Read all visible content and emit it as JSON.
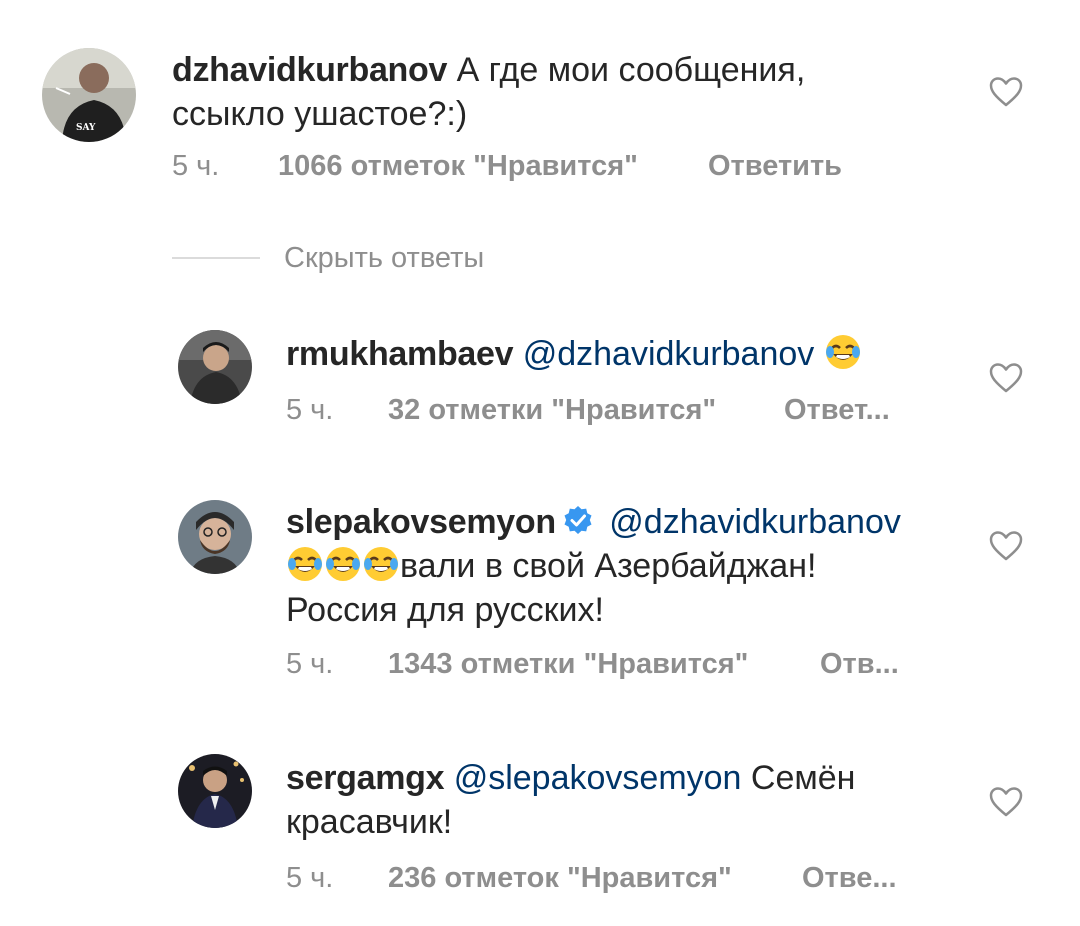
{
  "comments": [
    {
      "username": "dzhavidkurbanov",
      "mention": "",
      "text_line1": "А где мои сообщения,",
      "text_line2": "ссыкло ушастое?:)",
      "time": "5 ч.",
      "likes": "1066 отметок \"Нравится\"",
      "reply": "Ответить"
    }
  ],
  "hide_replies": "Скрыть ответы",
  "replies": [
    {
      "username": "rmukhambaev",
      "mention": "@dzhavidkurbanov",
      "time": "5 ч.",
      "likes": "32 отметки \"Нравится\"",
      "reply": "Ответ..."
    },
    {
      "username": "slepakovsemyon",
      "mention": "@dzhavidkurbanov",
      "text_line1": "вали в свой Азербайджан!",
      "text_line2": "Россия для русских!",
      "time": "5 ч.",
      "likes": "1343 отметки \"Нравится\"",
      "reply": "Отв..."
    },
    {
      "username": "sergamgx",
      "mention": "@slepakovsemyon",
      "text_line1": "Семён",
      "text_line2": "красавчик!",
      "time": "5 ч.",
      "likes": "236 отметок \"Нравится\"",
      "reply": "Отве..."
    }
  ],
  "icons": {
    "like": "heart-outline-icon",
    "verified": "verified-badge-icon",
    "emoji": "tears-of-joy-emoji"
  },
  "colors": {
    "text": "#262626",
    "secondary": "#8e8e8e",
    "mention": "#003569",
    "verified": "#3897f0"
  }
}
